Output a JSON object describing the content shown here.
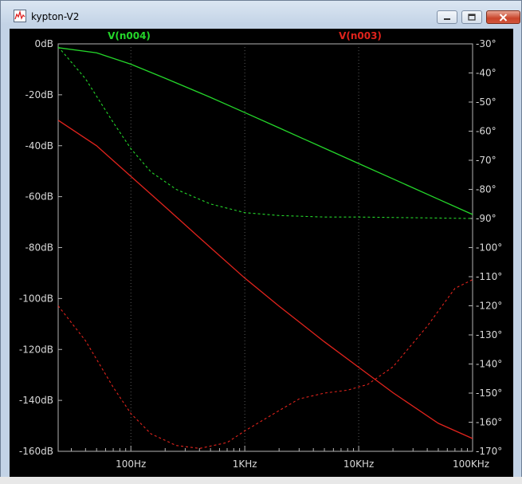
{
  "window": {
    "title": "kypton-V2",
    "icon": "waveform-icon",
    "controls": [
      "minimize-icon",
      "maximize-icon",
      "close-icon"
    ]
  },
  "colors": {
    "background": "#000000",
    "axis": "#b4b4b4",
    "grid": "#5a5a5a",
    "text": "#d8d8d8",
    "trace_green": "#24d62a",
    "trace_red": "#e0231c"
  },
  "chart_data": {
    "type": "line",
    "x_scale": "log",
    "xlim": [
      23,
      100000
    ],
    "x_ticks": [
      100,
      1000,
      10000,
      100000
    ],
    "x_tick_labels": [
      "100Hz",
      "1KHz",
      "10KHz",
      "100KHz"
    ],
    "left_axis": {
      "unit": "dB",
      "ylim": [
        -160,
        0
      ],
      "ticks": [
        0,
        -20,
        -40,
        -60,
        -80,
        -100,
        -120,
        -140,
        -160
      ],
      "tick_labels": [
        "0dB",
        "-20dB",
        "-40dB",
        "-60dB",
        "-80dB",
        "-100dB",
        "-120dB",
        "-140dB",
        "-160dB"
      ]
    },
    "right_axis": {
      "unit": "°",
      "ylim": [
        -170,
        -30
      ],
      "ticks": [
        -30,
        -40,
        -50,
        -60,
        -70,
        -80,
        -90,
        -100,
        -110,
        -120,
        -130,
        -140,
        -150,
        -160,
        -170
      ],
      "tick_labels": [
        "-30°",
        "-40°",
        "-50°",
        "-60°",
        "-70°",
        "-80°",
        "-90°",
        "-100°",
        "-110°",
        "-120°",
        "-130°",
        "-140°",
        "-150°",
        "-160°",
        "-170°"
      ]
    },
    "grid": true,
    "series": [
      {
        "name": "V(n004)",
        "color": "#24d62a",
        "magnitude_db": [
          [
            23,
            -1.5
          ],
          [
            50,
            -3.5
          ],
          [
            100,
            -8
          ],
          [
            200,
            -13.5
          ],
          [
            500,
            -21
          ],
          [
            1000,
            -27
          ],
          [
            2000,
            -33
          ],
          [
            5000,
            -41
          ],
          [
            10000,
            -47
          ],
          [
            20000,
            -53
          ],
          [
            50000,
            -61
          ],
          [
            100000,
            -67
          ]
        ],
        "phase_deg": [
          [
            23,
            -31
          ],
          [
            40,
            -42
          ],
          [
            70,
            -57
          ],
          [
            100,
            -66
          ],
          [
            150,
            -74
          ],
          [
            250,
            -80
          ],
          [
            500,
            -85
          ],
          [
            1000,
            -88
          ],
          [
            2000,
            -89
          ],
          [
            5000,
            -89.5
          ],
          [
            10000,
            -89.5
          ],
          [
            100000,
            -90
          ]
        ]
      },
      {
        "name": "V(n003)",
        "color": "#e0231c",
        "magnitude_db": [
          [
            23,
            -30
          ],
          [
            50,
            -40
          ],
          [
            100,
            -52
          ],
          [
            200,
            -64
          ],
          [
            500,
            -80
          ],
          [
            1000,
            -92
          ],
          [
            2000,
            -103
          ],
          [
            5000,
            -117
          ],
          [
            10000,
            -127
          ],
          [
            20000,
            -137
          ],
          [
            50000,
            -149
          ],
          [
            100000,
            -155
          ]
        ],
        "phase_deg": [
          [
            23,
            -120
          ],
          [
            40,
            -132
          ],
          [
            70,
            -148
          ],
          [
            100,
            -157
          ],
          [
            150,
            -164
          ],
          [
            250,
            -168
          ],
          [
            400,
            -169
          ],
          [
            700,
            -167
          ],
          [
            1000,
            -163
          ],
          [
            2000,
            -156
          ],
          [
            3000,
            -152
          ],
          [
            5000,
            -150
          ],
          [
            8000,
            -149
          ],
          [
            12000,
            -147
          ],
          [
            20000,
            -141
          ],
          [
            40000,
            -127
          ],
          [
            70000,
            -114
          ],
          [
            100000,
            -111
          ]
        ]
      }
    ]
  }
}
